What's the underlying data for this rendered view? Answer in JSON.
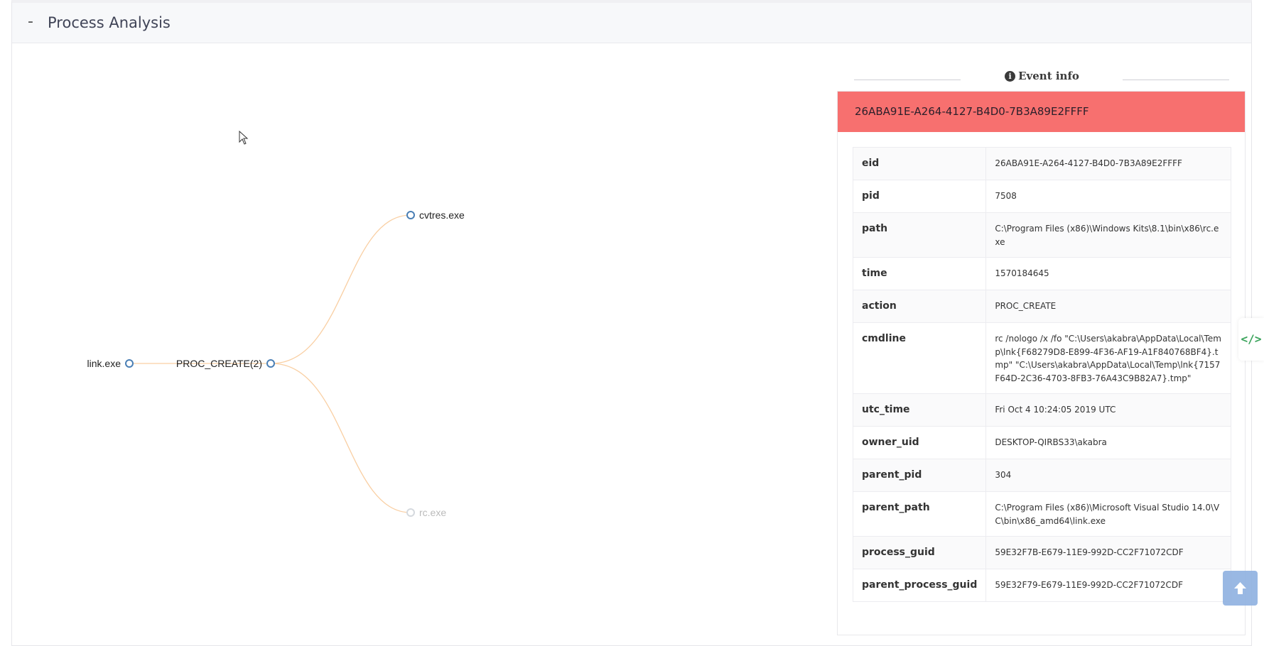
{
  "section": {
    "toggle": "-",
    "title": "Process Analysis"
  },
  "graph": {
    "root": "link.exe",
    "action_node": "PROC_CREATE(2)",
    "children": [
      "cvtres.exe",
      "rc.exe"
    ],
    "edge_color": "#f9cfa3",
    "node_stroke": "#4a7fb5",
    "faded_node": "rc.exe"
  },
  "event_info": {
    "heading": "Event info",
    "banner": "26ABA91E-A264-4127-B4D0-7B3A89E2FFFF",
    "banner_color": "#f7706f",
    "fields": [
      {
        "key": "eid",
        "value": "26ABA91E-A264-4127-B4D0-7B3A89E2FFFF"
      },
      {
        "key": "pid",
        "value": "7508"
      },
      {
        "key": "path",
        "value": "C:\\Program Files (x86)\\Windows Kits\\8.1\\bin\\x86\\rc.exe"
      },
      {
        "key": "time",
        "value": "1570184645"
      },
      {
        "key": "action",
        "value": "PROC_CREATE"
      },
      {
        "key": "cmdline",
        "value": "rc /nologo /x /fo \"C:\\Users\\akabra\\AppData\\Local\\Temp\\lnk{F68279D8-E899-4F36-AF19-A1F840768BF4}.tmp\" \"C:\\Users\\akabra\\AppData\\Local\\Temp\\lnk{7157F64D-2C36-4703-8FB3-76A43C9B82A7}.tmp\""
      },
      {
        "key": "utc_time",
        "value": "Fri Oct 4 10:24:05 2019 UTC"
      },
      {
        "key": "owner_uid",
        "value": "DESKTOP-QIRBS33\\akabra"
      },
      {
        "key": "parent_pid",
        "value": "304"
      },
      {
        "key": "parent_path",
        "value": "C:\\Program Files (x86)\\Microsoft Visual Studio 14.0\\VC\\bin\\x86_amd64\\link.exe"
      },
      {
        "key": "process_guid",
        "value": "59E32F7B-E679-11E9-992D-CC2F71072CDF"
      },
      {
        "key": "parent_process_guid",
        "value": "59E32F79-E679-11E9-992D-CC2F71072CDF"
      }
    ]
  },
  "side_tab": {
    "icon": "code-icon",
    "glyph": "</>"
  },
  "scroll_top": {
    "icon": "arrow-up-icon"
  }
}
